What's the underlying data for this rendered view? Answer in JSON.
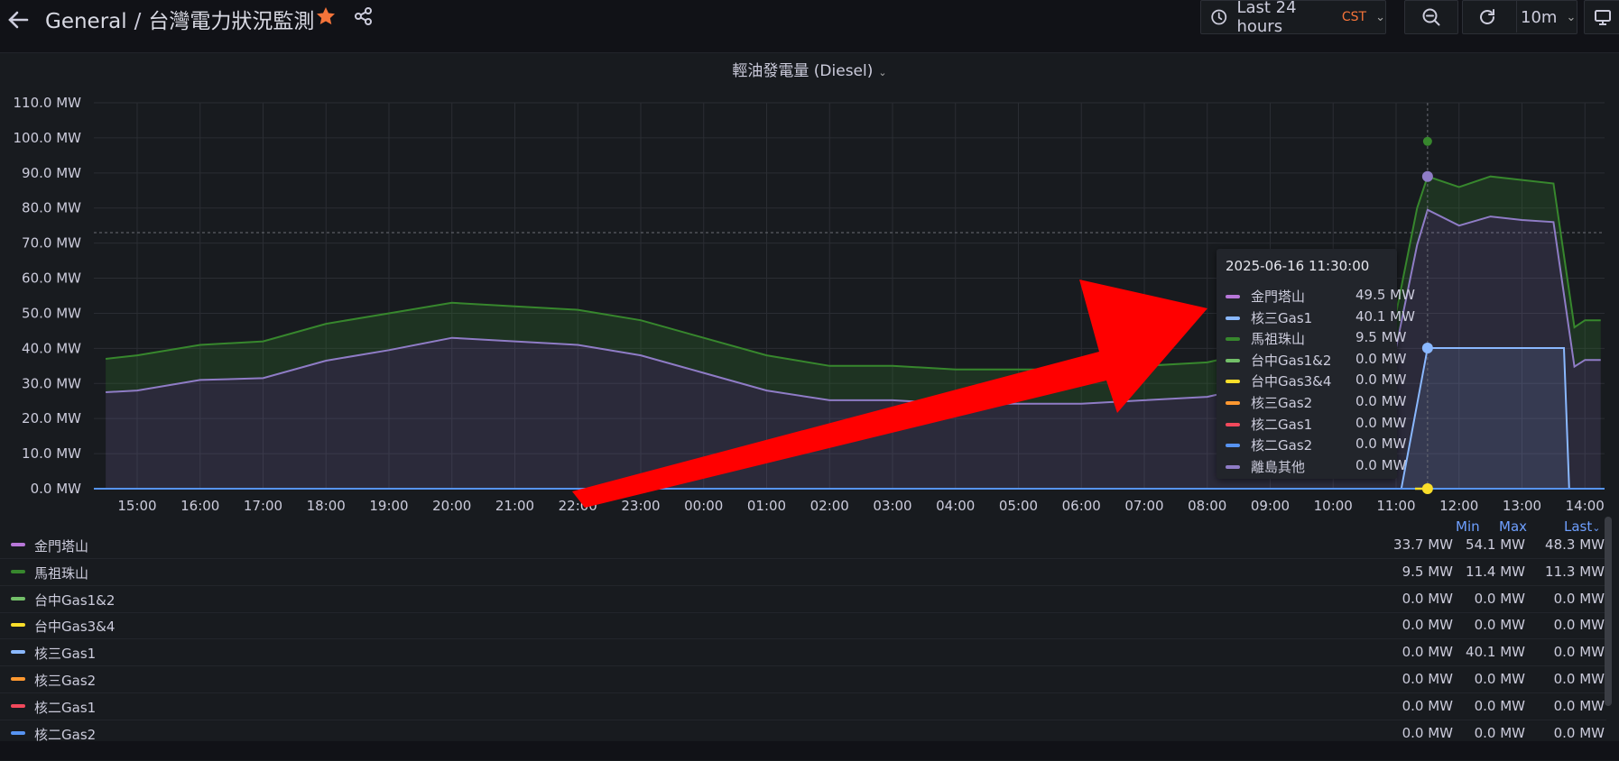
{
  "breadcrumb": {
    "folder": "General",
    "separator": "/",
    "dashboard": "台灣電力狀況監測"
  },
  "icons": [
    "arrow-left-icon",
    "star-icon",
    "share-icon",
    "clock-icon",
    "zoom-out-icon",
    "refresh-icon",
    "tv-icon"
  ],
  "time_picker": {
    "label": "Last 24 hours",
    "timezone": "CST"
  },
  "refresh": {
    "interval": "10m"
  },
  "panel": {
    "title": "輕油發電量 (Diesel)"
  },
  "colors": {
    "金門塔山": "#b877d9",
    "馬祖珠山": "#37872d",
    "台中Gas1&2": "#73bf69",
    "台中Gas3&4": "#fade2a",
    "核三Gas1": "#8ab8ff",
    "核三Gas2": "#ff9830",
    "核二Gas1": "#f2495c",
    "核二Gas2": "#5794f2",
    "離島其他": "#8f7cc6",
    "arrow": "#ff0000"
  },
  "chart_data": {
    "type": "area",
    "unit": "MW",
    "ylim": [
      0,
      110
    ],
    "y_ticks": [
      "0.0 MW",
      "10.0 MW",
      "20.0 MW",
      "30.0 MW",
      "40.0 MW",
      "50.0 MW",
      "60.0 MW",
      "70.0 MW",
      "80.0 MW",
      "90.0 MW",
      "100.0 MW",
      "110.0 MW"
    ],
    "x_ticks": [
      "15:00",
      "16:00",
      "17:00",
      "18:00",
      "19:00",
      "20:00",
      "21:00",
      "22:00",
      "23:00",
      "00:00",
      "01:00",
      "02:00",
      "03:00",
      "04:00",
      "05:00",
      "06:00",
      "07:00",
      "08:00",
      "09:00",
      "10:00",
      "11:00",
      "12:00",
      "13:00",
      "14:00"
    ],
    "threshold": 73,
    "cursor_time": "11:30",
    "series": [
      {
        "name": "金門塔山",
        "stacked_top": true,
        "x": [
          "14:30",
          "15:00",
          "16:00",
          "17:00",
          "18:00",
          "19:00",
          "20:00",
          "21:00",
          "22:00",
          "23:00",
          "00:00",
          "01:00",
          "02:00",
          "03:00",
          "04:00",
          "05:00",
          "06:00",
          "07:00",
          "08:00",
          "09:00",
          "10:00",
          "11:00",
          "11:20",
          "11:30",
          "12:00",
          "12:30",
          "13:00",
          "13:30",
          "13:50",
          "14:00",
          "14:15"
        ],
        "values": [
          37,
          38,
          41,
          42,
          47,
          50,
          53,
          52,
          51,
          48,
          43,
          38,
          35,
          35,
          34,
          34,
          34,
          35,
          36,
          40,
          45,
          50,
          80,
          89,
          86,
          89,
          88,
          87,
          46,
          48,
          48
        ]
      },
      {
        "name": "馬祖珠山",
        "x": [
          "14:30",
          "15:00",
          "16:00",
          "17:00",
          "18:00",
          "19:00",
          "20:00",
          "21:00",
          "22:00",
          "23:00",
          "00:00",
          "01:00",
          "02:00",
          "03:00",
          "04:00",
          "05:00",
          "06:00",
          "07:00",
          "08:00",
          "09:00",
          "10:00",
          "11:00",
          "11:20",
          "11:30",
          "12:00",
          "12:30",
          "13:00",
          "13:30",
          "13:50",
          "14:00",
          "14:15"
        ],
        "values": [
          9.5,
          10,
          10,
          10.5,
          10.5,
          10.5,
          10,
          10,
          10,
          10,
          10,
          10,
          9.8,
          9.8,
          9.8,
          9.8,
          9.8,
          9.8,
          9.8,
          9.8,
          9.8,
          9.8,
          10.5,
          9.5,
          11,
          11.4,
          11.4,
          11,
          11.2,
          11.3,
          11.3
        ]
      },
      {
        "name": "核三Gas1",
        "x": [
          "14:30",
          "11:05",
          "11:30",
          "12:00",
          "13:00",
          "13:40",
          "13:45",
          "14:15"
        ],
        "values": [
          0,
          0,
          40.1,
          40.1,
          40.1,
          40.1,
          0,
          0
        ]
      }
    ],
    "tooltip": {
      "time": "2025-06-16 11:30:00",
      "rows": [
        {
          "name": "金門塔山",
          "value": "49.5 MW"
        },
        {
          "name": "核三Gas1",
          "value": "40.1 MW"
        },
        {
          "name": "馬祖珠山",
          "value": "9.5 MW"
        },
        {
          "name": "台中Gas1&2",
          "value": "0.0 MW"
        },
        {
          "name": "台中Gas3&4",
          "value": "0.0 MW"
        },
        {
          "name": "核三Gas2",
          "value": "0.0 MW"
        },
        {
          "name": "核二Gas1",
          "value": "0.0 MW"
        },
        {
          "name": "核二Gas2",
          "value": "0.0 MW"
        },
        {
          "name": "離島其他",
          "value": "0.0 MW"
        }
      ]
    }
  },
  "legend": {
    "headers": {
      "min": "Min",
      "max": "Max",
      "last": "Last"
    },
    "rows": [
      {
        "name": "金門塔山",
        "min": "33.7 MW",
        "max": "54.1 MW",
        "last": "48.3 MW"
      },
      {
        "name": "馬祖珠山",
        "min": "9.5 MW",
        "max": "11.4 MW",
        "last": "11.3 MW"
      },
      {
        "name": "台中Gas1&2",
        "min": "0.0 MW",
        "max": "0.0 MW",
        "last": "0.0 MW"
      },
      {
        "name": "台中Gas3&4",
        "min": "0.0 MW",
        "max": "0.0 MW",
        "last": "0.0 MW"
      },
      {
        "name": "核三Gas1",
        "min": "0.0 MW",
        "max": "40.1 MW",
        "last": "0.0 MW"
      },
      {
        "name": "核三Gas2",
        "min": "0.0 MW",
        "max": "0.0 MW",
        "last": "0.0 MW"
      },
      {
        "name": "核二Gas1",
        "min": "0.0 MW",
        "max": "0.0 MW",
        "last": "0.0 MW"
      },
      {
        "name": "核二Gas2",
        "min": "0.0 MW",
        "max": "0.0 MW",
        "last": "0.0 MW"
      }
    ]
  }
}
